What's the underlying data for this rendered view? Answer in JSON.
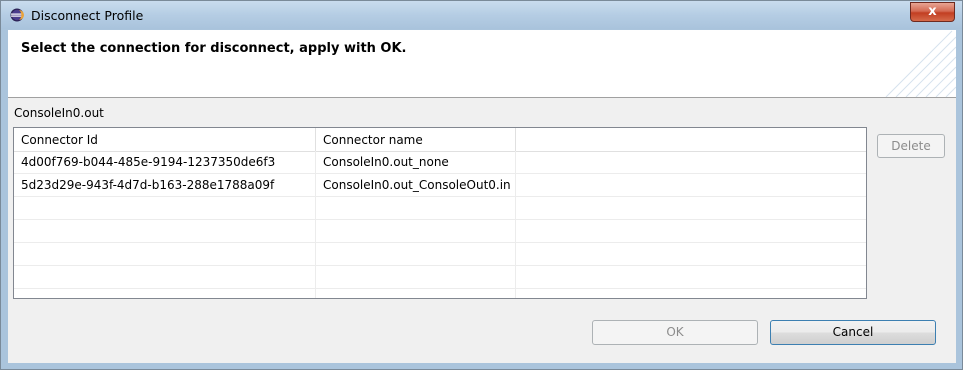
{
  "window": {
    "title": "Disconnect Profile",
    "close_label": "x"
  },
  "banner": {
    "message": "Select the connection for disconnect, apply with OK."
  },
  "group": {
    "label": "ConsoleIn0.out"
  },
  "table": {
    "columns": [
      "Connector Id",
      "Connector name",
      ""
    ],
    "rows": [
      {
        "id": "4d00f769-b044-485e-9194-1237350de6f3",
        "name": "ConsoleIn0.out_none"
      },
      {
        "id": "5d23d29e-943f-4d7d-b163-288e1788a09f",
        "name": "ConsoleIn0.out_ConsoleOut0.in"
      }
    ]
  },
  "buttons": {
    "delete": "Delete",
    "ok": "OK",
    "cancel": "Cancel"
  }
}
